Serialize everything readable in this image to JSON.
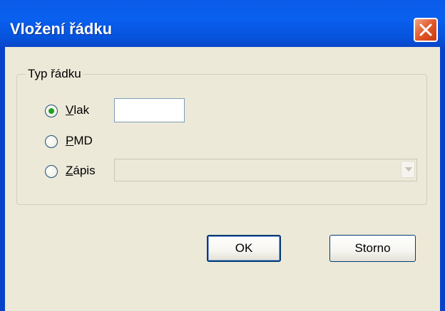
{
  "dialog": {
    "title": "Vložení řádku",
    "close_icon": "close-icon",
    "colors": {
      "titlebar": "#0a5ce8",
      "client": "#ece9d8",
      "close_button": "#e2582a",
      "radio_dot": "#21a121"
    }
  },
  "group": {
    "legend": "Typ řádku",
    "options": [
      {
        "label_mnemonic": "V",
        "label_rest": "lak",
        "checked": true
      },
      {
        "label_mnemonic": "P",
        "label_rest": "MD",
        "checked": false
      },
      {
        "label_mnemonic": "Z",
        "label_rest": "ápis",
        "checked": false
      }
    ],
    "vlak_input_value": "",
    "zapis_combo_value": "",
    "zapis_combo_icon": "dropdown-arrow-icon"
  },
  "buttons": {
    "ok_label": "OK",
    "cancel_label": "Storno"
  }
}
